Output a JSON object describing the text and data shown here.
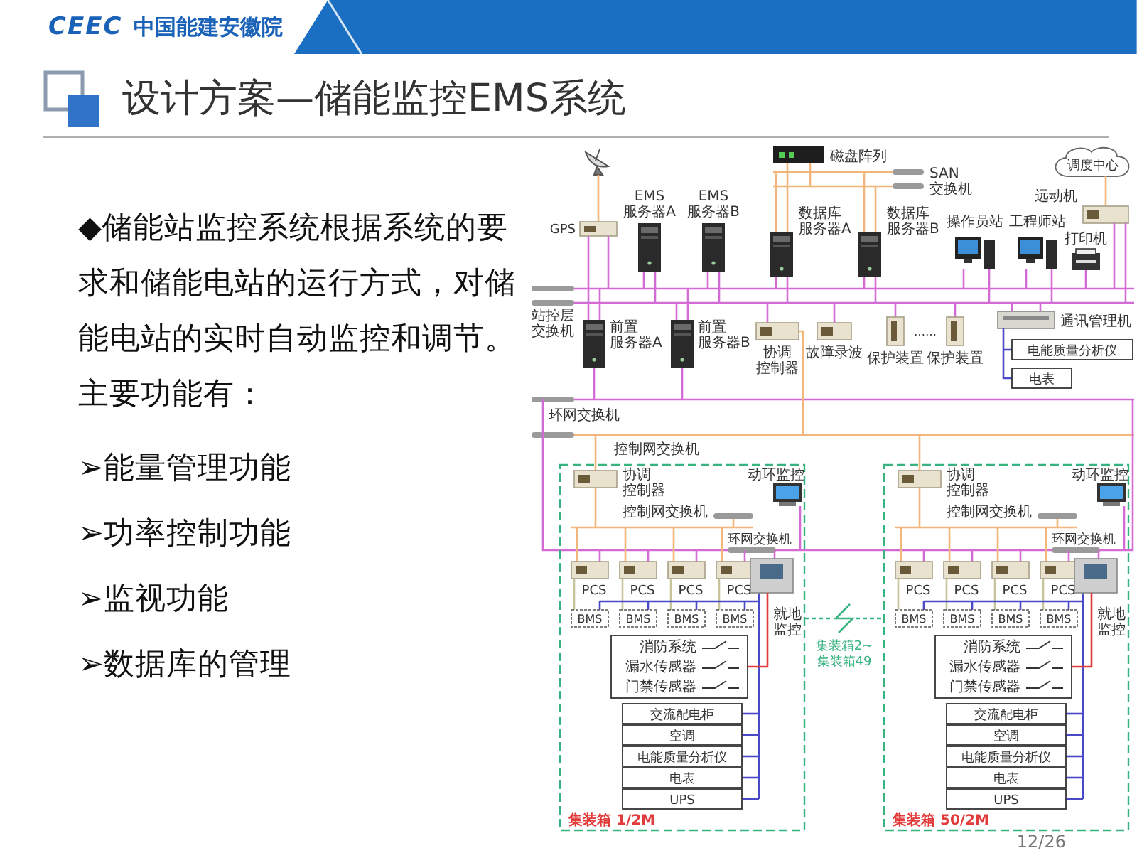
{
  "header": {
    "logo": "CEEC",
    "org": "中国能建安徽院"
  },
  "title": "设计方案—储能监控EMS系统",
  "intro": "◆储能站监控系统根据系统的要求和储能电站的运行方式，对储能电站的实时自动监控和调节。主要功能有：",
  "functions": [
    "➢能量管理功能",
    "➢功率控制功能",
    "➢监视功能",
    "➢数据库的管理"
  ],
  "diagram": {
    "station": {
      "gps": "GPS",
      "ems_servers": [
        [
          "EMS",
          "服务器A"
        ],
        [
          "EMS",
          "服务器B"
        ]
      ],
      "disk_array": "磁盘阵列",
      "san_switch": [
        "SAN",
        "交换机"
      ],
      "db_servers": [
        [
          "数据库",
          "服务器A"
        ],
        [
          "数据库",
          "服务器B"
        ]
      ],
      "workstations": [
        "操作员站",
        "工程师站"
      ],
      "printer": "打印机",
      "dispatch_center": "调度中心",
      "telecontrol": "远动机",
      "station_switch": [
        "站控层",
        "交换机"
      ],
      "front_servers": [
        [
          "前置",
          "服务器A"
        ],
        [
          "前置",
          "服务器B"
        ]
      ],
      "coordinator": [
        "协调",
        "控制器"
      ],
      "fault_recorder": "故障录波",
      "protection": [
        "保护装置",
        "保护装置"
      ],
      "ellipsis": "……",
      "comm_manager": "通讯管理机",
      "comm_devices": [
        "电能质量分析仪",
        "电表"
      ],
      "ring_switch": "环网交换机",
      "control_switch": "控制网交换机"
    },
    "clusters": [
      {
        "coordinator": [
          "协调",
          "控制器"
        ],
        "control_switch": "控制网交换机",
        "monitor": "动环监控",
        "ring_switch": "环网交换机",
        "pcs": [
          "PCS",
          "PCS",
          "PCS",
          "PCS"
        ],
        "bms": [
          "BMS",
          "BMS",
          "BMS",
          "BMS"
        ],
        "local_monitor": "就地监控",
        "sensors": [
          "消防系统",
          "漏水传感器",
          "门禁传感器"
        ],
        "equipment": [
          "交流配电柜",
          "空调",
          "电能质量分析仪",
          "电表",
          "UPS"
        ],
        "name": "集装箱 1/2M"
      },
      {
        "coordinator": [
          "协调",
          "控制器"
        ],
        "control_switch": "控制网交换机",
        "monitor": "动环监控",
        "ring_switch": "环网交换机",
        "pcs": [
          "PCS",
          "PCS",
          "PCS",
          "PCS"
        ],
        "bms": [
          "BMS",
          "BMS",
          "BMS",
          "BMS"
        ],
        "local_monitor": "就地监控",
        "sensors": [
          "消防系统",
          "漏水传感器",
          "门禁传感器"
        ],
        "equipment": [
          "交流配电柜",
          "空调",
          "电能质量分析仪",
          "电表",
          "UPS"
        ],
        "name": "集装箱 50/2M"
      }
    ],
    "link": [
      "集装箱2~",
      "集装箱49"
    ]
  },
  "page_number": "12/26"
}
